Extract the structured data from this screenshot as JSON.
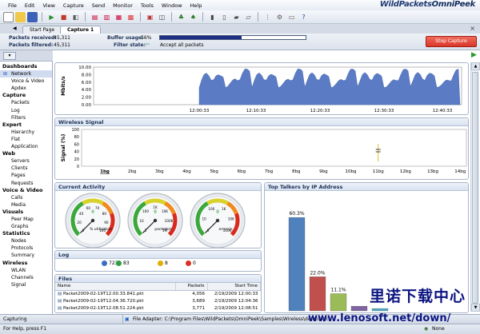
{
  "menu": [
    "File",
    "Edit",
    "View",
    "Capture",
    "Send",
    "Monitor",
    "Tools",
    "Window",
    "Help"
  ],
  "brand": {
    "part1": "WildPackets",
    "part2": "OmniPeek"
  },
  "tabs": {
    "start": "Start Page",
    "capture": "Capture 1",
    "close": "×"
  },
  "info": {
    "received_label": "Packets received:",
    "received_value": "45,311",
    "filtered_label": "Packets filtered:",
    "filtered_value": "45,311",
    "buffer_label": "Buffer usage:",
    "buffer_value": "56%",
    "buffer_fraction": 0.56,
    "filter_label": "Filter state:",
    "filter_value": "Accept all packets",
    "stop_button": "Stop Capture"
  },
  "sidebar": [
    {
      "group": "Dashboards",
      "items": [
        "Network",
        "Voice & Video",
        "Apdex"
      ]
    },
    {
      "group": "Capture",
      "items": [
        "Packets",
        "Log",
        "Filters"
      ]
    },
    {
      "group": "Expert",
      "items": [
        "Hierarchy",
        "Flat",
        "Application"
      ]
    },
    {
      "group": "Web",
      "items": [
        "Servers",
        "Clients",
        "Pages",
        "Requests"
      ]
    },
    {
      "group": "Voice & Video",
      "items": [
        "Calls",
        "Media"
      ]
    },
    {
      "group": "Visuals",
      "items": [
        "Peer Map",
        "Graphs"
      ]
    },
    {
      "group": "Statistics",
      "items": [
        "Nodes",
        "Protocols",
        "Summary"
      ]
    },
    {
      "group": "Wireless",
      "items": [
        "WLAN",
        "Channels",
        "Signal"
      ]
    }
  ],
  "selected_nav": "Network",
  "network_chart": {
    "ylabel": "Mbits/s",
    "yticks": [
      "10.00",
      "8.00",
      "6.00",
      "4.00",
      "2.00",
      "0.00"
    ],
    "xticks": [
      "12:00:33",
      "12:10:33",
      "12:20:33",
      "12:30:33",
      "12:40:33"
    ]
  },
  "wireless": {
    "title": "Wireless Signal",
    "ylabel": "Signal (%)",
    "yticks": [
      "100",
      "80",
      "60",
      "40",
      "20",
      "0"
    ],
    "channels": [
      "1bg",
      "2bg",
      "3bg",
      "4bg",
      "5bg",
      "6bg",
      "7bg",
      "8bg",
      "9bg",
      "10bg",
      "11bg",
      "12bg",
      "13bg",
      "14bg"
    ]
  },
  "activity": {
    "title": "Current Activity",
    "gauges": [
      {
        "unit": "% utilization",
        "ticks": [
          "0",
          "20",
          "40",
          "60",
          "70",
          "80",
          "90",
          "100"
        ],
        "value_text": "0"
      },
      {
        "unit": "packets/s",
        "ticks": [
          "1",
          "10",
          "100",
          "1K",
          "10K",
          "100K",
          "1M"
        ],
        "value_text": "0"
      },
      {
        "unit": "errors/s",
        "ticks": [
          "0",
          "10",
          "100",
          "1K",
          "10K",
          "100K"
        ],
        "value_text": "0"
      }
    ]
  },
  "log": {
    "title": "Log",
    "counts": [
      {
        "label": "723",
        "color": "#3a6fc4"
      },
      {
        "label": "83",
        "color": "#2ea043"
      },
      {
        "label": "8",
        "color": "#e0b000"
      },
      {
        "label": "0",
        "color": "#d93025"
      }
    ]
  },
  "files": {
    "title": "Files",
    "columns": [
      "Name",
      "Packets",
      "Start Time"
    ],
    "rows": [
      {
        "name": "Packet2009-02-19T12.00.33.841.pkt",
        "packets": "4,056",
        "start": "2/19/2009 12:00:33"
      },
      {
        "name": "Packet2009-02-19T12.04.36.720.pkt",
        "packets": "3,689",
        "start": "2/19/2009 12:04:36"
      },
      {
        "name": "Packet2009-02-19T12.08.51.224.pkt",
        "packets": "3,771",
        "start": "2/19/2009 12:08:51"
      }
    ]
  },
  "top_talkers": {
    "title": "Top Talkers by IP Address",
    "bars": [
      {
        "label": "60.3%",
        "value": 60.3,
        "color": "#4f81bd"
      },
      {
        "label": "22.0%",
        "value": 22.0,
        "color": "#c0504d"
      },
      {
        "label": "11.1%",
        "value": 11.1,
        "color": "#9bbb59"
      },
      {
        "label": "",
        "value": 3.0,
        "color": "#8064a2"
      },
      {
        "label": "",
        "value": 1.5,
        "color": "#4bacc6"
      }
    ]
  },
  "status": {
    "state": "Capturing",
    "file": "File Adapter: C:\\Program Files\\WildPackets\\OmniPeek\\Samples\\Wireless\\demo.apc",
    "help": "For Help, press F1",
    "none": "None"
  },
  "watermark": {
    "cn": "里诺下载中心",
    "url": "www.lenosoft.net/down/"
  }
}
